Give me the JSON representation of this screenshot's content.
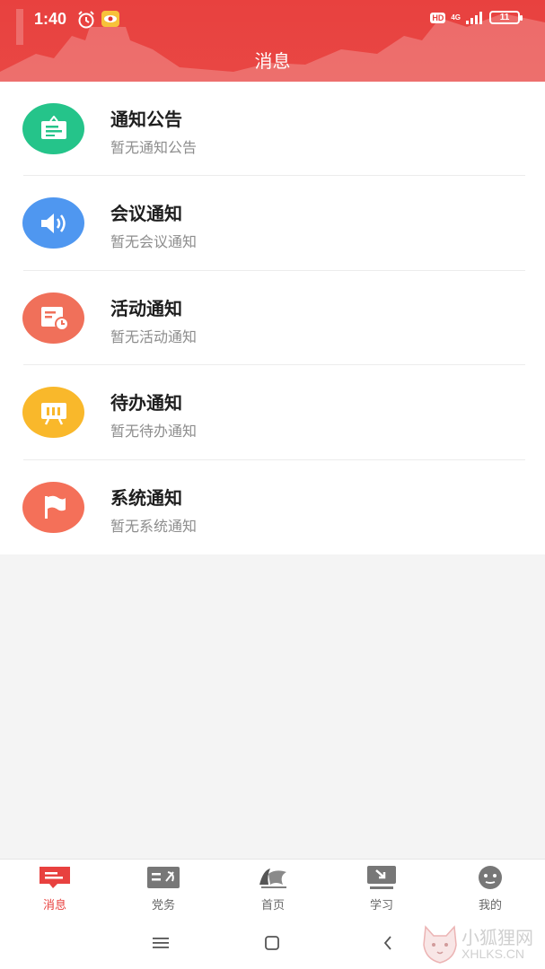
{
  "status_bar": {
    "time": "1:40",
    "hd": "HD",
    "network": "4G",
    "battery": "11"
  },
  "header": {
    "title": "消息"
  },
  "messages": [
    {
      "title": "通知公告",
      "subtitle": "暂无通知公告",
      "icon": "notice-board-icon",
      "color": "#25c48a"
    },
    {
      "title": "会议通知",
      "subtitle": "暂无会议通知",
      "icon": "speaker-icon",
      "color": "#4f97f0"
    },
    {
      "title": "活动通知",
      "subtitle": "暂无活动通知",
      "icon": "activity-clock-icon",
      "color": "#f0705a"
    },
    {
      "title": "待办通知",
      "subtitle": "暂无待办通知",
      "icon": "presentation-board-icon",
      "color": "#f9b82b"
    },
    {
      "title": "系统通知",
      "subtitle": "暂无系统通知",
      "icon": "flag-icon",
      "color": "#f47059"
    }
  ],
  "tabs": [
    {
      "label": "消息",
      "icon": "message-icon",
      "active": true
    },
    {
      "label": "党务",
      "icon": "party-affairs-icon",
      "active": false
    },
    {
      "label": "首页",
      "icon": "home-logo-icon",
      "active": false
    },
    {
      "label": "学习",
      "icon": "study-icon",
      "active": false
    },
    {
      "label": "我的",
      "icon": "profile-face-icon",
      "active": false
    }
  ],
  "watermark": {
    "title": "小狐狸网",
    "subtitle": "XHLKS.CN"
  },
  "colors": {
    "brand_red": "#e8413f",
    "text_primary": "#1e1e1e",
    "text_secondary": "#8d8d8d"
  }
}
